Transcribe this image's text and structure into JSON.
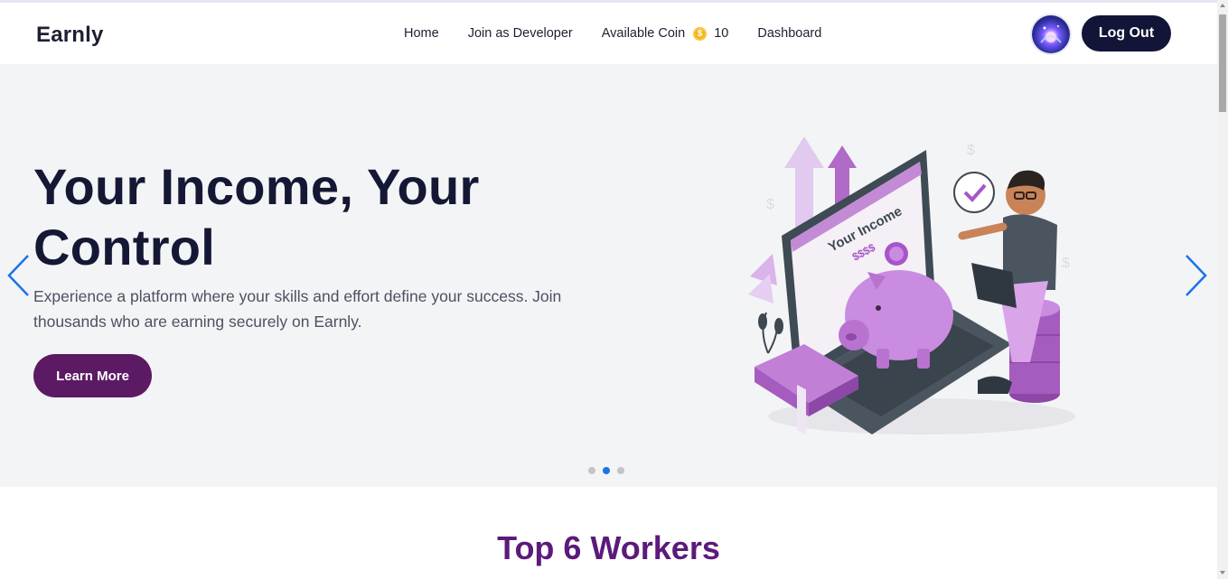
{
  "navbar": {
    "brand": "Earnly",
    "links": {
      "home": "Home",
      "join_developer": "Join as Developer",
      "available_coin_label": "Available Coin",
      "coin_count": "10",
      "dashboard": "Dashboard"
    },
    "coin_icon": "coin-icon",
    "logout_label": "Log Out"
  },
  "hero": {
    "title": "Your Income, Your Control",
    "description": "Experience a platform where your skills and effort define your success. Join thousands who are earning securely on Earnly.",
    "cta_label": "Learn More",
    "illustration_text": {
      "screen_label": "Your Income",
      "screen_amount": "$$$$"
    },
    "slides": {
      "count": 3,
      "active_index": 1
    }
  },
  "section": {
    "title": "Top 6 Workers"
  },
  "colors": {
    "brand_dark": "#121537",
    "cta_purple": "#5c1a64",
    "section_title": "#5c1a7a",
    "arrow_blue": "#1a73e8",
    "hero_bg": "#f3f4f6",
    "coin": "#f5b51a"
  }
}
